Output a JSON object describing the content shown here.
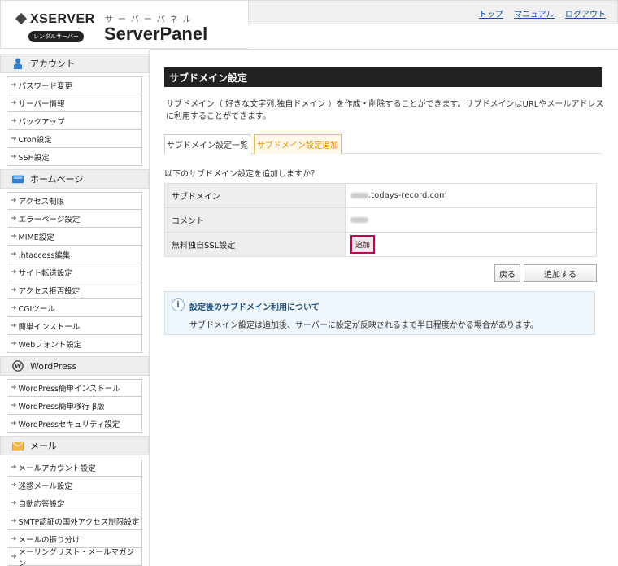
{
  "header": {
    "brand": "XSERVER",
    "rental_badge": "レンタルサーバー",
    "kana": "サーバーパネル",
    "panel_title": "ServerPanel",
    "links": [
      "トップ",
      "マニュアル",
      "ログアウト"
    ]
  },
  "sidebar": {
    "sections": [
      {
        "title": "アカウント",
        "icon": "user-icon",
        "items": [
          "パスワード変更",
          "サーバー情報",
          "バックアップ",
          "Cron設定",
          "SSH設定"
        ]
      },
      {
        "title": "ホームページ",
        "icon": "homepage-icon",
        "items": [
          "アクセス制限",
          "エラーページ設定",
          "MIME設定",
          ".htaccess編集",
          "サイト転送設定",
          "アクセス拒否設定",
          "CGIツール",
          "簡単インストール",
          "Webフォント設定"
        ]
      },
      {
        "title": "WordPress",
        "icon": "wordpress-icon",
        "items": [
          "WordPress簡単インストール",
          "WordPress簡単移行 β版",
          "WordPressセキュリティ設定"
        ]
      },
      {
        "title": "メール",
        "icon": "mail-icon",
        "items": [
          "メールアカウント設定",
          "迷惑メール設定",
          "自動応答設定",
          "SMTP認証の国外アクセス制限設定",
          "メールの振り分け",
          "メーリングリスト・メールマガジン"
        ]
      }
    ]
  },
  "main": {
    "title": "サブドメイン設定",
    "description": "サブドメイン（ 好きな文字列.独自ドメイン ）を作成・削除することができます。サブドメインはURLやメールアドレスに利用することができます。",
    "tabs": [
      "サブドメイン設定一覧",
      "サブドメイン設定追加"
    ],
    "confirm": "以下のサブドメイン設定を追加しますか？",
    "rows": [
      {
        "label": "サブドメイン",
        "value": ".todays-record.com"
      },
      {
        "label": "コメント",
        "value": ""
      },
      {
        "label": "無料独自SSL設定",
        "value": "追加"
      }
    ],
    "buttons": {
      "back": "戻る",
      "submit": "追加する"
    },
    "info": {
      "title": "設定後のサブドメイン利用について",
      "body": "サブドメイン設定は追加後、サーバーに設定が反映されるまで半日程度かかる場合があります。"
    }
  },
  "colors": {
    "accent_tab": "#e68a00",
    "highlight_border": "#c4004f",
    "title_bar": "#222222"
  }
}
